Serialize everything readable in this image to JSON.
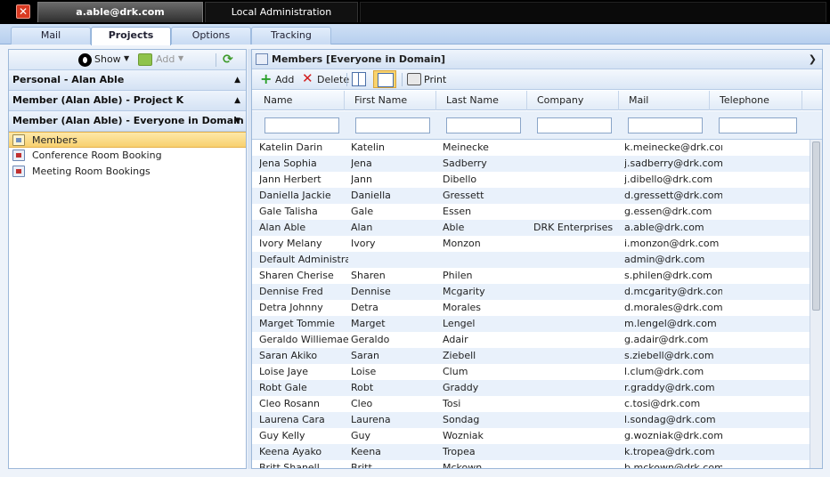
{
  "topbar": {
    "user_tab": "a.able@drk.com",
    "admin_tab": "Local Administration"
  },
  "module_tabs": [
    {
      "label": "Mail"
    },
    {
      "label": "Projects"
    },
    {
      "label": "Options"
    },
    {
      "label": "Tracking"
    }
  ],
  "left_toolbar": {
    "show_label": "Show",
    "add_label": "Add"
  },
  "groups": [
    {
      "label": "Personal - Alan Able"
    },
    {
      "label": "Member (Alan Able) - Project K"
    },
    {
      "label": "Member (Alan Able) - Everyone in Domain"
    }
  ],
  "nav_items": [
    {
      "label": "Members"
    },
    {
      "label": "Conference Room Booking"
    },
    {
      "label": "Meeting Room Bookings"
    }
  ],
  "right_panel": {
    "title": "Members [Everyone in Domain]",
    "add_label": "Add",
    "delete_label": "Delete",
    "print_label": "Print"
  },
  "columns": [
    "Name",
    "First Name",
    "Last Name",
    "Company",
    "Mail",
    "Telephone"
  ],
  "rows": [
    [
      "Katelin Darin",
      "Katelin",
      "Meinecke",
      "",
      "k.meinecke@drk.com",
      ""
    ],
    [
      "Jena Sophia",
      "Jena",
      "Sadberry",
      "",
      "j.sadberry@drk.com",
      ""
    ],
    [
      "Jann Herbert",
      "Jann",
      "Dibello",
      "",
      "j.dibello@drk.com",
      ""
    ],
    [
      "Daniella Jackie",
      "Daniella",
      "Gressett",
      "",
      "d.gressett@drk.com",
      ""
    ],
    [
      "Gale Talisha",
      "Gale",
      "Essen",
      "",
      "g.essen@drk.com",
      ""
    ],
    [
      "Alan Able",
      "Alan",
      "Able",
      "DRK Enterprises",
      "a.able@drk.com",
      ""
    ],
    [
      "Ivory Melany",
      "Ivory",
      "Monzon",
      "",
      "i.monzon@drk.com",
      ""
    ],
    [
      "Default Administrators",
      "",
      "",
      "",
      "admin@drk.com",
      ""
    ],
    [
      "Sharen Cherise",
      "Sharen",
      "Philen",
      "",
      "s.philen@drk.com",
      ""
    ],
    [
      "Dennise Fred",
      "Dennise",
      "Mcgarity",
      "",
      "d.mcgarity@drk.com",
      ""
    ],
    [
      "Detra Johnny",
      "Detra",
      "Morales",
      "",
      "d.morales@drk.com",
      ""
    ],
    [
      "Marget Tommie",
      "Marget",
      "Lengel",
      "",
      "m.lengel@drk.com",
      ""
    ],
    [
      "Geraldo Williemae",
      "Geraldo",
      "Adair",
      "",
      "g.adair@drk.com",
      ""
    ],
    [
      "Saran Akiko",
      "Saran",
      "Ziebell",
      "",
      "s.ziebell@drk.com",
      ""
    ],
    [
      "Loise Jaye",
      "Loise",
      "Clum",
      "",
      "l.clum@drk.com",
      ""
    ],
    [
      "Robt Gale",
      "Robt",
      "Graddy",
      "",
      "r.graddy@drk.com",
      ""
    ],
    [
      "Cleo Rosann",
      "Cleo",
      "Tosi",
      "",
      "c.tosi@drk.com",
      ""
    ],
    [
      "Laurena Cara",
      "Laurena",
      "Sondag",
      "",
      "l.sondag@drk.com",
      ""
    ],
    [
      "Guy Kelly",
      "Guy",
      "Wozniak",
      "",
      "g.wozniak@drk.com",
      ""
    ],
    [
      "Keena Ayako",
      "Keena",
      "Tropea",
      "",
      "k.tropea@drk.com",
      ""
    ],
    [
      "Britt Shanell",
      "Britt",
      "Mckown",
      "",
      "b.mckown@drk.com",
      ""
    ]
  ]
}
